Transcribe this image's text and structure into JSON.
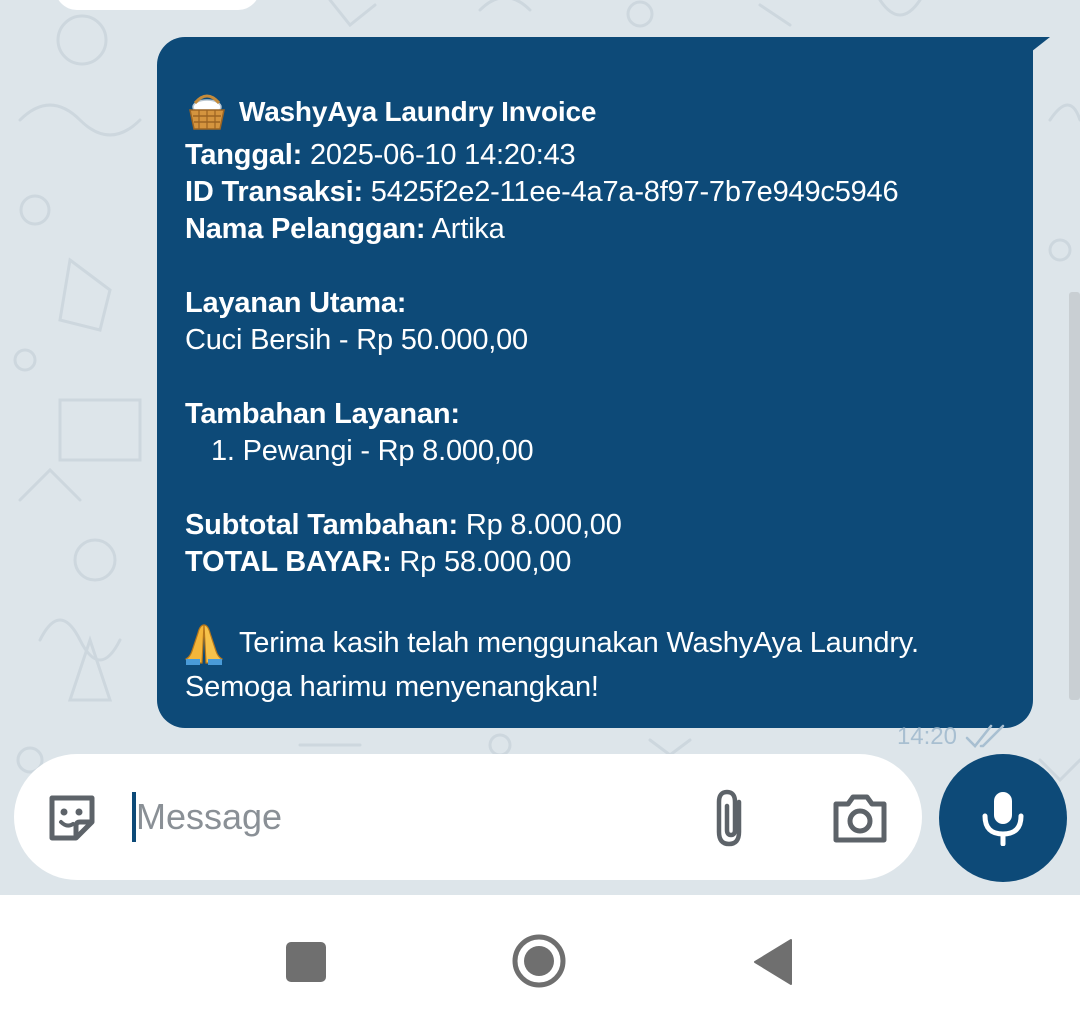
{
  "invoice": {
    "title": "WashyAya Laundry Invoice",
    "date_label": "Tanggal:",
    "date_value": "2025-06-10 14:20:43",
    "id_label": "ID Transaksi:",
    "id_value": "5425f2e2-11ee-4a7a-8f97-7b7e949c5946",
    "customer_label": "Nama Pelanggan:",
    "customer_value": "Artika",
    "main_service_label": "Layanan Utama:",
    "main_service_value": "Cuci Bersih - Rp 50.000,00",
    "extra_service_label": "Tambahan Layanan:",
    "extra_services": [
      "1. Pewangi - Rp 8.000,00"
    ],
    "subtotal_label": "Subtotal Tambahan:",
    "subtotal_value": "Rp 8.000,00",
    "total_label": "TOTAL BAYAR:",
    "total_value": "Rp 58.000,00",
    "thanks_line1": "Terima kasih telah menggunakan WashyAya Laundry.",
    "thanks_line2": "Semoga harimu menyenangkan!"
  },
  "message_meta": {
    "time": "14:20",
    "status": "read"
  },
  "composer": {
    "placeholder": "Message"
  },
  "icons": {
    "title_emoji": "basket-icon",
    "thanks_emoji": "folded-hands-icon",
    "sticker": "sticker-icon",
    "attach": "paperclip-icon",
    "camera": "camera-icon",
    "mic": "mic-icon",
    "ticks": "double-check-icon"
  },
  "colors": {
    "bubble": "#0d4a78",
    "chat_background": "#dde5ea",
    "accent": "#0d4a78"
  }
}
